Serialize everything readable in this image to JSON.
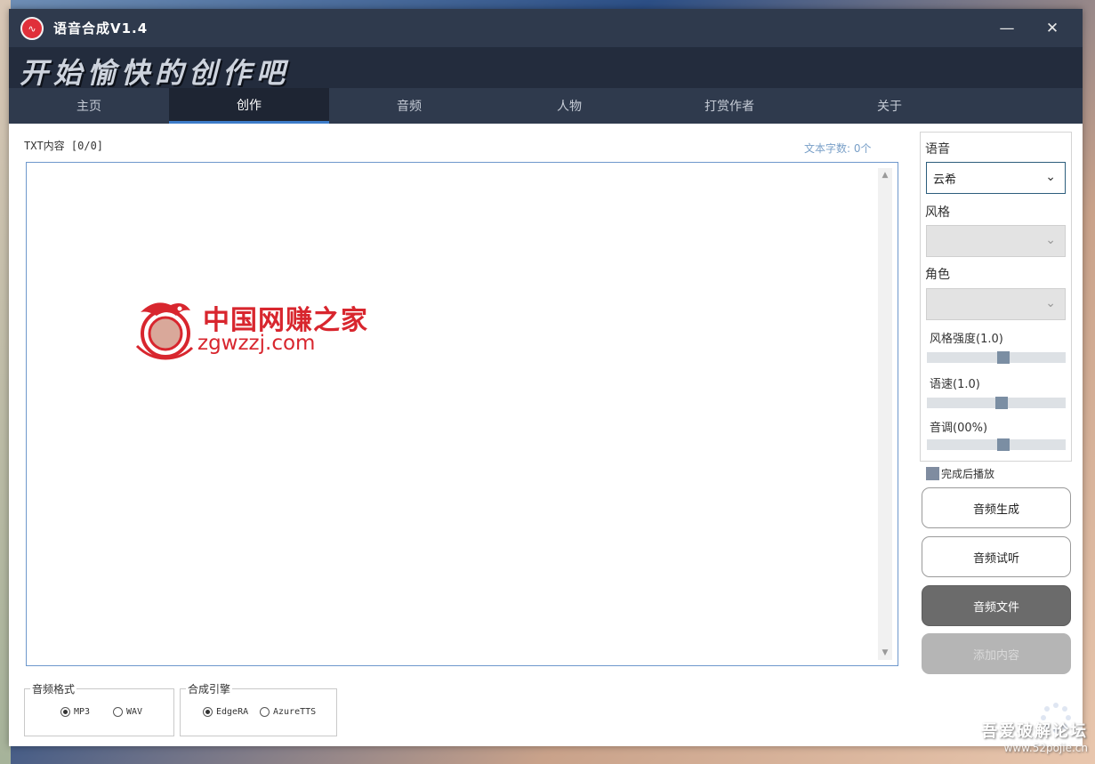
{
  "window": {
    "title": "语音合成V1.4",
    "minimize_glyph": "—",
    "close_glyph": "✕"
  },
  "banner": {
    "slogan": "开始愉快的创作吧"
  },
  "tabs": [
    {
      "label": "主页",
      "active": false
    },
    {
      "label": "创作",
      "active": true
    },
    {
      "label": "音频",
      "active": false
    },
    {
      "label": "人物",
      "active": false
    },
    {
      "label": "打赏作者",
      "active": false
    },
    {
      "label": "关于",
      "active": false
    }
  ],
  "editor": {
    "txt_label": "TXT内容  [0/0]",
    "char_count": "文本字数: 0个",
    "content": ""
  },
  "watermark": {
    "name": "中国网赚之家",
    "url": "zgwzzj.com"
  },
  "audio_format": {
    "label": "音频格式",
    "options": [
      {
        "label": "MP3",
        "selected": true
      },
      {
        "label": "WAV",
        "selected": false
      }
    ]
  },
  "engine": {
    "label": "合成引擎",
    "options": [
      {
        "label": "EdgeRA",
        "selected": true
      },
      {
        "label": "AzureTTS",
        "selected": false
      }
    ]
  },
  "settings": {
    "voice_label": "语音",
    "voice_value": "云希",
    "style_label": "风格",
    "style_value": "",
    "role_label": "角色",
    "role_value": "",
    "sliders": [
      {
        "label": "风格强度(1.0)",
        "value": 0.55
      },
      {
        "label": "语速(1.0)",
        "value": 0.54
      },
      {
        "label": "音调(00%)",
        "value": 0.55
      }
    ],
    "checkbox_label": "完成后播放"
  },
  "buttons": {
    "generate": "音频生成",
    "preview": "音频试听",
    "file": "音频文件",
    "add": "添加内容"
  },
  "forum": {
    "title": "吾爱破解论坛",
    "url": "www.52pojie.cn"
  },
  "colors": {
    "titlebar": "#2f3a4d",
    "tab_active_underline": "#3d7cc9",
    "watermark_red": "#d8262e"
  }
}
